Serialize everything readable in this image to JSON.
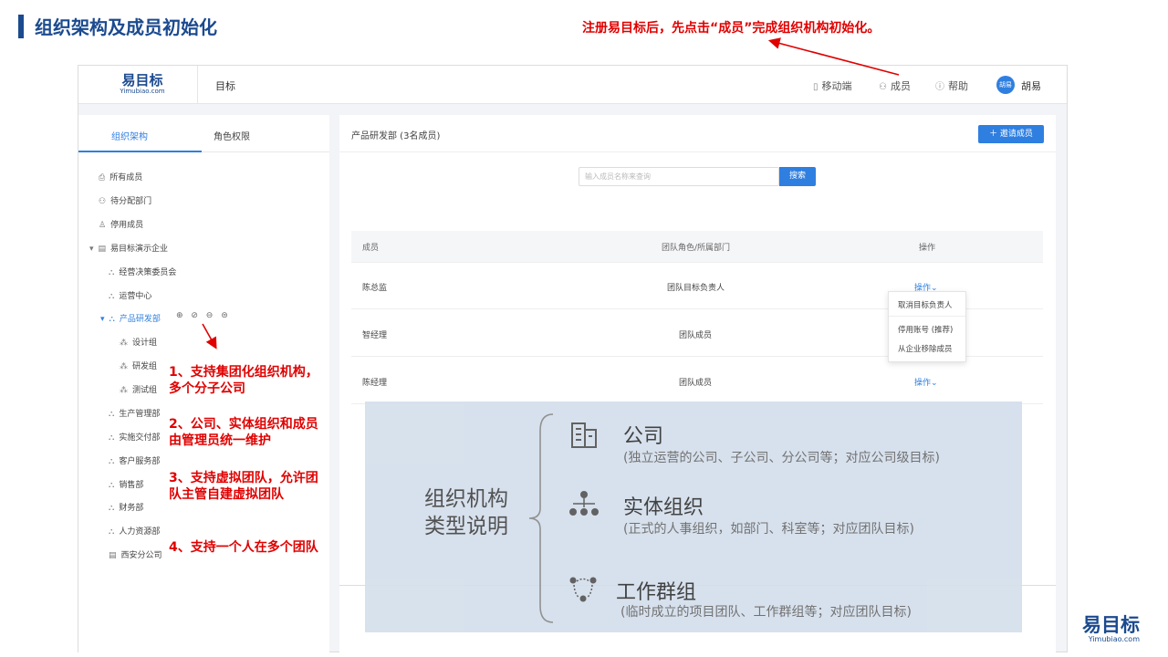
{
  "slide": {
    "title": "组织架构及成员初始化",
    "note": "注册易目标后，先点击“成员”完成组织机构初始化。"
  },
  "app": {
    "logo_main": "易目标",
    "logo_sub": "Yimubiao.com",
    "nav_goal": "目标",
    "header": {
      "mobile": "移动端",
      "members": "成员",
      "help": "帮助",
      "avatar_text": "胡易",
      "user_name": "胡易"
    },
    "left_tabs": [
      "组织架构",
      "角色权限"
    ],
    "tree": [
      {
        "label": "所有成员",
        "icon": "printer-icon"
      },
      {
        "label": "待分配部门",
        "icon": "users-icon"
      },
      {
        "label": "停用成员",
        "icon": "user-disabled-icon"
      },
      {
        "label": "易目标演示企业",
        "icon": "building-icon"
      },
      {
        "label": "经营决策委员会",
        "icon": "org-icon"
      },
      {
        "label": "运营中心",
        "icon": "org-icon"
      },
      {
        "label": "产品研发部",
        "icon": "org-icon"
      },
      {
        "label": "设计组",
        "icon": "group-icon"
      },
      {
        "label": "研发组",
        "icon": "group-icon"
      },
      {
        "label": "测试组",
        "icon": "group-icon"
      },
      {
        "label": "生产管理部",
        "icon": "org-icon"
      },
      {
        "label": "实施交付部",
        "icon": "org-icon"
      },
      {
        "label": "客户服务部",
        "icon": "org-icon"
      },
      {
        "label": "销售部",
        "icon": "org-icon"
      },
      {
        "label": "财务部",
        "icon": "org-icon"
      },
      {
        "label": "人力资源部",
        "icon": "org-icon"
      },
      {
        "label": "西安分公司",
        "icon": "building-icon"
      }
    ],
    "tree_actions": "⊕ ⊘ ⊖ ⊜",
    "dept_title": "产品研发部 (3名成员)",
    "invite_btn": "＋ 邀请成员",
    "search_placeholder": "输入成员名称来查询",
    "search_btn": "搜索",
    "table": {
      "headers": [
        "成员",
        "团队角色/所属部门",
        "操作"
      ],
      "rows": [
        {
          "name": "陈总监",
          "role": "团队目标负责人",
          "op": "操作⌄"
        },
        {
          "name": "智经理",
          "role": "团队成员",
          "op": ""
        },
        {
          "name": "陈经理",
          "role": "团队成员",
          "op": "操作⌄"
        }
      ]
    },
    "dropdown": [
      "取消目标负责人",
      "停用账号 (推荐)",
      "从企业移除成员"
    ]
  },
  "annotations": [
    "1、支持集团化组织机构，多个分子公司",
    "2、公司、实体组织和成员由管理员统一维护",
    "3、支持虚拟团队，允许团队主管自建虚拟团队",
    "4、支持一个人在多个团队"
  ],
  "overlay": {
    "main": "组织机构类型说明",
    "items": [
      {
        "title": "公司",
        "desc": "(独立运营的公司、子公司、分公司等；对应公司级目标)"
      },
      {
        "title": "实体组织",
        "desc": "(正式的人事组织，如部门、科室等；对应团队目标)"
      },
      {
        "title": "工作群组",
        "desc": "(临时成立的项目团队、工作群组等；对应团队目标)"
      }
    ]
  },
  "brand": {
    "main": "易目标",
    "sub": "Yimubiao.com"
  },
  "colors": {
    "accent": "#2f7fe0",
    "brand": "#1b4a8f",
    "annotation": "#e00000",
    "overlay": "#d4dfec"
  }
}
